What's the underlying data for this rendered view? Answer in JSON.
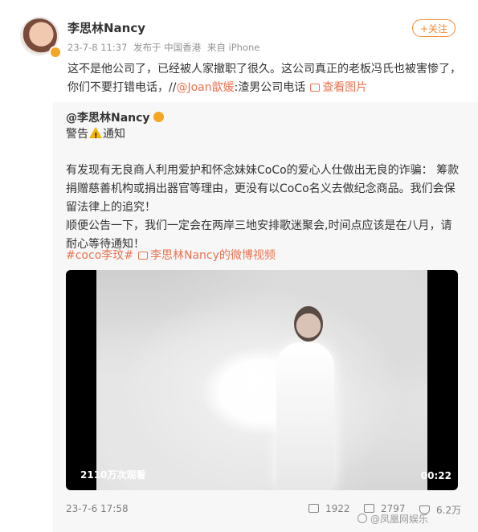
{
  "post": {
    "author": "李思林Nancy",
    "date": "23-7-8 11:37",
    "location": "发布于 中国香港",
    "source": "来自 iPhone",
    "follow_label": "+关注",
    "text_part1": "这不是他公司了，已经被人家撤职了很久。这公司真正的老板冯氏也被害惨了，你们不要打错电话，//",
    "mention": "@Joan歆媛",
    "text_part2": ":渣男公司电话",
    "view_image_label": "查看图片"
  },
  "repost": {
    "author_handle": "@李思林Nancy",
    "title_prefix": "警告",
    "title_suffix": "通知",
    "paragraph1": "有发现有无良商人利用爱护和怀念妹妹CoCo的爱心人仕做出无良的诈骗： 筹款捐赠慈善机构或捐出器官等理由，更没有以CoCo名义去做纪念商品。我们会保留法律上的追究！",
    "paragraph2": "顺便公告一下，我们一定会在两岸三地安排歌迷聚会,时间点应该是在八月，请耐心等待通知！",
    "tag": "#coco李玟#",
    "video_link": "李思林Nancy的微博视频",
    "video": {
      "views": "2110万次观看",
      "duration": "00:22"
    },
    "date": "23-7-6 17:58",
    "reposts": "1922",
    "comments": "2797",
    "likes": "6.2万"
  },
  "watermark": "@凤凰网娱乐"
}
